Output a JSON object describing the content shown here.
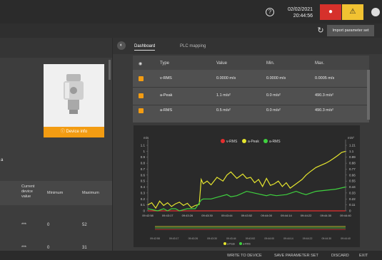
{
  "header": {
    "date": "02/02/2021",
    "time": "20:44:56",
    "alert_red_icon": "bell-icon",
    "alert_yellow_icon": "warning-icon",
    "help_icon": "?",
    "colors": {
      "red": "#d6312b",
      "yellow": "#f1c232",
      "accent": "#f39c12"
    }
  },
  "toolbar": {
    "import_label": "Import parameter set",
    "refresh_icon": "refresh-icon"
  },
  "left": {
    "device_info_label": "Device info",
    "side_label": "a",
    "table": {
      "headers": [
        "Current device value",
        "Minimum",
        "Maximum"
      ],
      "rows": [
        [
          "***",
          "0",
          "52"
        ],
        [
          "***",
          "0",
          "31"
        ]
      ]
    }
  },
  "tabs": [
    {
      "label": "Dashboard",
      "active": true
    },
    {
      "label": "PLC mapping",
      "active": false
    }
  ],
  "grid": {
    "headers": [
      "Type",
      "Value",
      "Min.",
      "Max."
    ],
    "rows": [
      {
        "type": "v-RMS",
        "value": "0.0000 m/s",
        "min": "0.0000 m/s",
        "max": "0.0005 m/s"
      },
      {
        "type": "a-Peak",
        "value": "1.1 m/s²",
        "min": "0.0 m/s²",
        "max": "490.3 m/s²"
      },
      {
        "type": "a-RMS",
        "value": "0.5 m/s²",
        "min": "0.0 m/s²",
        "max": "490.3 m/s²"
      }
    ]
  },
  "chart_data": {
    "type": "line",
    "title": "",
    "left_unit": "m/s",
    "right_unit": "m/s²",
    "legend": [
      "v-RMS",
      "a-Peak",
      "a-RMS"
    ],
    "legend_position": "top-center",
    "x": [
      "09:42:58",
      "09:43:17",
      "09:43:26",
      "09:43:30",
      "09:43:44",
      "09:43:52",
      "09:44:00",
      "09:44:14",
      "09:44:22",
      "09:44:30",
      "09:44:40"
    ],
    "ylim_left": [
      0,
      1.1
    ],
    "y_left_ticks": [
      "1.1",
      "1",
      "0.9",
      "0.8",
      "0.7",
      "0.6",
      "0.5",
      "0.4",
      "0.3",
      "0.2",
      "0.1",
      "0"
    ],
    "ylim_right": [
      0,
      1.21
    ],
    "y_right_ticks": [
      "1.21",
      "1.1",
      "0.99",
      "0.88",
      "0.77",
      "0.66",
      "0.55",
      "0.44",
      "0.33",
      "0.22",
      "0.11",
      "0"
    ],
    "grid": false,
    "series": [
      {
        "name": "v-RMS",
        "color": "#e52e2e",
        "axis": "left",
        "t": [
          0,
          1
        ],
        "values": [
          0.0,
          0.0
        ]
      },
      {
        "name": "a-Peak",
        "color": "#e5e52e",
        "axis": "right",
        "t": [
          0,
          0.02,
          0.04,
          0.06,
          0.08,
          0.1,
          0.12,
          0.14,
          0.16,
          0.18,
          0.2,
          0.22,
          0.24,
          0.26,
          0.27,
          0.28,
          0.3,
          0.32,
          0.35,
          0.38,
          0.4,
          0.42,
          0.45,
          0.48,
          0.5,
          0.52,
          0.54,
          0.56,
          0.58,
          0.6,
          0.62,
          0.64,
          0.66,
          0.68,
          0.7,
          0.72,
          0.75,
          0.78,
          0.8,
          0.82,
          0.85,
          0.88,
          0.9,
          0.92,
          0.94,
          0.96,
          0.98,
          1.0
        ],
        "values": [
          0.11,
          0.15,
          0.05,
          0.18,
          0.1,
          0.15,
          0.08,
          0.13,
          0.16,
          0.1,
          0.14,
          0.06,
          0.1,
          0.12,
          0.58,
          0.5,
          0.55,
          0.48,
          0.62,
          0.55,
          0.66,
          0.72,
          0.6,
          0.68,
          0.6,
          0.62,
          0.52,
          0.58,
          0.45,
          0.6,
          0.47,
          0.5,
          0.55,
          0.45,
          0.52,
          0.42,
          0.5,
          0.58,
          0.66,
          0.72,
          0.8,
          0.85,
          0.88,
          0.92,
          0.97,
          1.02,
          1.08,
          1.1
        ]
      },
      {
        "name": "a-RMS",
        "color": "#3fd13f",
        "axis": "right",
        "t": [
          0,
          0.05,
          0.08,
          0.1,
          0.12,
          0.14,
          0.16,
          0.2,
          0.24,
          0.27,
          0.28,
          0.32,
          0.36,
          0.4,
          0.42,
          0.45,
          0.5,
          0.55,
          0.6,
          0.62,
          0.65,
          0.7,
          0.75,
          0.78,
          0.8,
          0.85,
          0.9,
          0.95,
          1.0
        ],
        "values": [
          0.04,
          0.0,
          0.04,
          0.0,
          0.04,
          0.04,
          0.0,
          0.04,
          0.04,
          0.2,
          0.22,
          0.22,
          0.26,
          0.3,
          0.26,
          0.28,
          0.36,
          0.32,
          0.28,
          0.3,
          0.28,
          0.3,
          0.36,
          0.32,
          0.3,
          0.36,
          0.38,
          0.4,
          0.44
        ]
      }
    ]
  },
  "footer": {
    "write_label": "WRITE TO DEVICE",
    "save_label": "SAVE PARAMETER SET",
    "discard_label": "DISCARD",
    "edit_label": "EXIT"
  }
}
